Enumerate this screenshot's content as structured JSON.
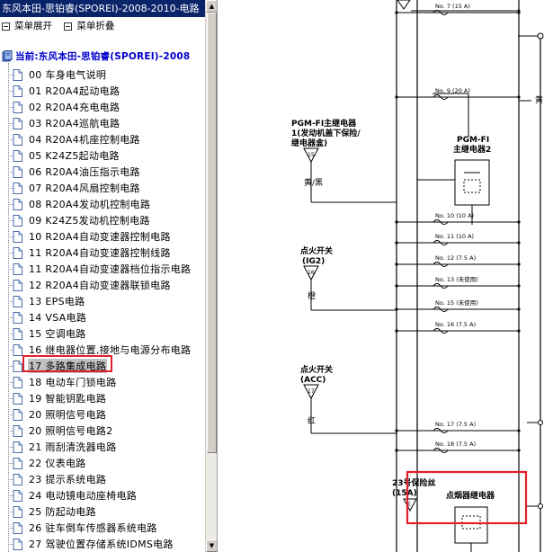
{
  "window": {
    "title": "东风本田-思铂睿(SPOREI)-2008-2010-电路"
  },
  "toolbar": {
    "expand_label": "菜单展开",
    "collapse_label": "菜单折叠"
  },
  "tree": {
    "root_label": "当前:东风本田-思铂睿(SPOREI)-2008",
    "items": [
      {
        "label": "00 车身电气说明"
      },
      {
        "label": "01 R20A4起动电路"
      },
      {
        "label": "02 R20A4充电电路"
      },
      {
        "label": "03 R20A4巡航电路"
      },
      {
        "label": "04 R20A4机座控制电路"
      },
      {
        "label": "05 K24Z5起动电路"
      },
      {
        "label": "06 R20A4油压指示电路"
      },
      {
        "label": "07 R20A4风扇控制电路"
      },
      {
        "label": "08 R20A4发动机控制电路"
      },
      {
        "label": "09 K24Z5发动机控制电路"
      },
      {
        "label": "10 R20A4自动变速器控制电路"
      },
      {
        "label": "11 R20A4自动变速器控制线路"
      },
      {
        "label": "11 R20A4自动变速器档位指示电路"
      },
      {
        "label": "12 R20A4自动变速器联锁电路"
      },
      {
        "label": "13 EPS电路"
      },
      {
        "label": "14 VSA电路"
      },
      {
        "label": "15 空调电路"
      },
      {
        "label": "16 继电器位置,接地与电源分布电路"
      },
      {
        "label": "17 多路集成电路"
      },
      {
        "label": "18 电动车门锁电路"
      },
      {
        "label": "19 智能钥匙电路"
      },
      {
        "label": "20 照明信号电路"
      },
      {
        "label": "20 照明信号电路2"
      },
      {
        "label": "21 雨刮清洗器电路"
      },
      {
        "label": "22 仪表电路"
      },
      {
        "label": "23 提示系统电路"
      },
      {
        "label": "24 电动镜电动座椅电路"
      },
      {
        "label": "25 防起动电路"
      },
      {
        "label": "26 驻车倒车传感器系统电路"
      },
      {
        "label": "27 驾驶位置存储系统IDMS电路"
      }
    ],
    "selected_index": 18
  },
  "diagram": {
    "fuses": [
      {
        "label": "No. 7 (15 A)"
      },
      {
        "label": "No. 9 (20 A)"
      },
      {
        "label": "No. 10 (10 A)"
      },
      {
        "label": "No. 11 (10 A)"
      },
      {
        "label": "No. 12 (7.5 A)"
      },
      {
        "label": "No. 13 (未使用)"
      },
      {
        "label": "No. 15 (未使用)"
      },
      {
        "label": "No. 16 (7.5 A)"
      },
      {
        "label": "No. 17 (7.5 A)"
      },
      {
        "label": "No. 18 (7.5 A)"
      }
    ],
    "main_relay_1": {
      "line1": "PGM-FI主继电器",
      "line2": "1(发动机盖下保险/",
      "line3": "继电器盒)",
      "pin": "15",
      "wire": "黄/黑"
    },
    "main_relay_2": {
      "line1": "PGM-FI",
      "line2": "主继电器2"
    },
    "ig2": {
      "line1": "点火开关",
      "line2": "(IG2)",
      "pin": "16",
      "wire": "橙"
    },
    "acc": {
      "line1": "点火开关",
      "line2": "(ACC)",
      "pin": "17",
      "wire": "红"
    },
    "fuse23": {
      "line1": "23号保险丝",
      "line2": "(15A)"
    },
    "lighter_relay": {
      "label": "点烟器继电器",
      "pin": "E"
    },
    "wire_yellow": "黄",
    "accent": "#e0202a"
  }
}
